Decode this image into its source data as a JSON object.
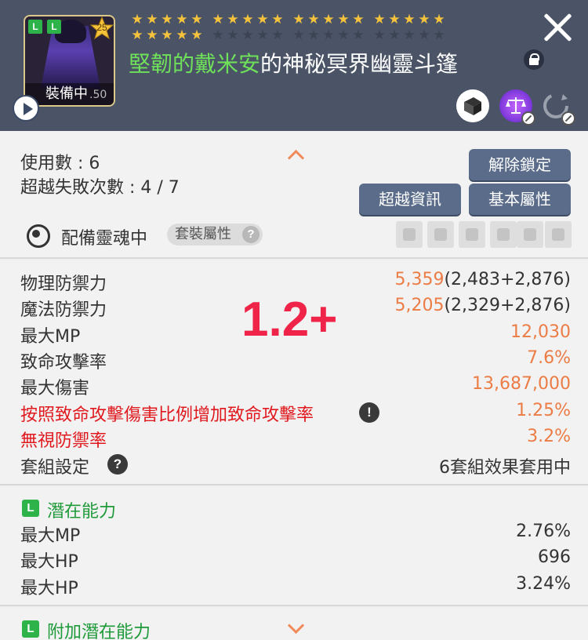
{
  "header": {
    "badges": [
      "L",
      "L"
    ],
    "star_level": "25",
    "equipped_label": "裝備中",
    "level_suffix": ".50",
    "title_green": "堅韌的戴米安",
    "title_rest": "的神秘冥界幽靈斗篷",
    "stars_filled": 25,
    "stars_total": 40,
    "icons": [
      "play-icon",
      "lock-icon",
      "close-icon",
      "box-icon",
      "scale-icon",
      "cycle-icon"
    ]
  },
  "summary": {
    "uses_label": "使用數 : 6",
    "fails_label": "超越失敗次數 : 4 / 7",
    "unlock_button": "解除鎖定",
    "transcend_button": "超越資訊",
    "base_attr_button": "基本屬性",
    "soul_label": "配備靈魂中",
    "set_attr_label": "套裝屬性"
  },
  "overlay_text": "1.2+",
  "stats": [
    {
      "label": "物理防禦力",
      "value": "5,359",
      "detail": "(2,483+2,876)",
      "red": false
    },
    {
      "label": "魔法防禦力",
      "value": "5,205",
      "detail": "(2,329+2,876)",
      "red": false
    },
    {
      "label": "最大MP",
      "value": "12,030",
      "detail": "",
      "red": false
    },
    {
      "label": "致命攻擊率",
      "value": "7.6%",
      "detail": "",
      "red": false
    },
    {
      "label": "最大傷害",
      "value": "13,687,000",
      "detail": "",
      "red": false
    },
    {
      "label": "按照致命攻擊傷害比例增加致命攻擊率",
      "value": "1.25%",
      "detail": "",
      "red": true
    },
    {
      "label": "無視防禦率",
      "value": "3.2%",
      "detail": "",
      "red": true
    }
  ],
  "set_setting": {
    "label": "套組設定",
    "value": "6套組效果套用中"
  },
  "potential": {
    "badge": "L",
    "title": "潛在能力",
    "lines": [
      {
        "label": "最大MP",
        "value": "2.76%"
      },
      {
        "label": "最大HP",
        "value": "696"
      },
      {
        "label": "最大HP",
        "value": "3.24%"
      }
    ]
  },
  "bonus_potential": {
    "badge": "L",
    "title": "附加潛在能力"
  },
  "colors": {
    "header_bg": "#4a5466",
    "accent_orange": "#ec7c45",
    "accent_red": "#e0191f",
    "legendary_green": "#2db34a",
    "overlay_red": "#f02448"
  }
}
